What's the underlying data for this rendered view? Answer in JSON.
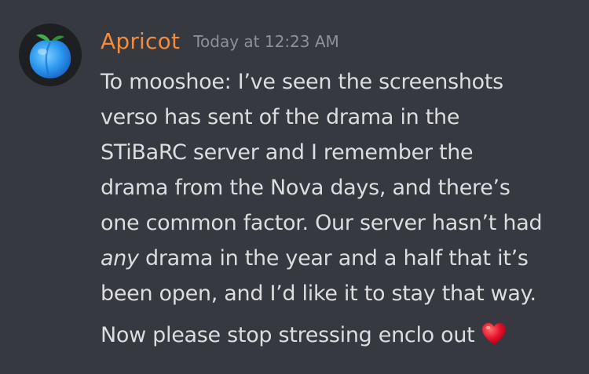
{
  "message": {
    "author": "Apricot",
    "timestamp": "Today at 12:23 AM",
    "avatar_icon": "peach-emoji-icon",
    "line1": "To mooshoe: I’ve seen the screenshots",
    "line2": "verso has sent of the drama in the",
    "line3": "STiBaRC server and I remember the",
    "line4": "drama from the Nova days, and there’s",
    "line5": "one common factor. Our server hasn’t had",
    "line6_emph": "any",
    "line6_rest": " drama in the year and a half that it’s",
    "line7": "been open, and I’d like it to stay that way.",
    "line8": "Now please stop stressing enclo out",
    "emoji_icon": "red-heart-icon"
  },
  "colors": {
    "background": "#36393f",
    "author": "#f48a3a",
    "timestamp": "#8e9297",
    "text": "#dcddde"
  }
}
